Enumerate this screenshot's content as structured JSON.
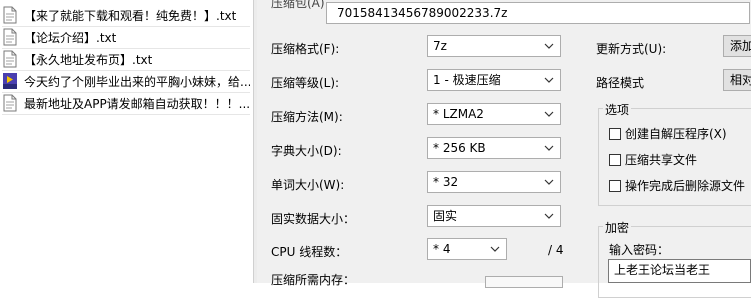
{
  "files": [
    {
      "name": "【来了就能下载和观看！纯免费！】.txt",
      "icon": "txt-file-icon"
    },
    {
      "name": "【论坛介绍】.txt",
      "icon": "txt-file-icon"
    },
    {
      "name": "【永久地址发布页】.txt",
      "icon": "txt-file-icon"
    },
    {
      "name": "今天约了个刚毕业出来的平胸小妹妹，给...",
      "icon": "mp4-file-icon",
      "icon_text": "MP4"
    },
    {
      "name": "最新地址及APP请发邮箱自动获取！！！....",
      "icon": "txt-file-icon"
    }
  ],
  "dialog": {
    "archive_label": "压缩包(A)",
    "archive_value": "70158413456789002233.7z",
    "format_label": "压缩格式(F):",
    "format_value": "7z",
    "level_label": "压缩等级(L):",
    "level_value": "1 - 极速压缩",
    "method_label": "压缩方法(M):",
    "method_value": "* LZMA2",
    "dict_label": "字典大小(D):",
    "dict_value": "* 256 KB",
    "word_label": "单词大小(W):",
    "word_value": "* 32",
    "solid_label": "固实数据大小：",
    "solid_value": "固实",
    "cpu_label": "CPU 线程数：",
    "cpu_value": "* 4",
    "cpu_total": "/ 4",
    "memory_label": "压缩所需内存：",
    "update_label": "更新方式(U):",
    "update_value": "添加",
    "pathmode_label": "路径模式",
    "pathmode_value": "相对",
    "options_title": "选项",
    "options": [
      {
        "label": "创建自解压程序(X)",
        "checked": false
      },
      {
        "label": "压缩共享文件",
        "checked": false
      },
      {
        "label": "操作完成后删除源文件",
        "checked": false
      }
    ],
    "encrypt_title": "加密",
    "password_label": "输入密码：",
    "password_value": "上老王论坛当老王"
  }
}
